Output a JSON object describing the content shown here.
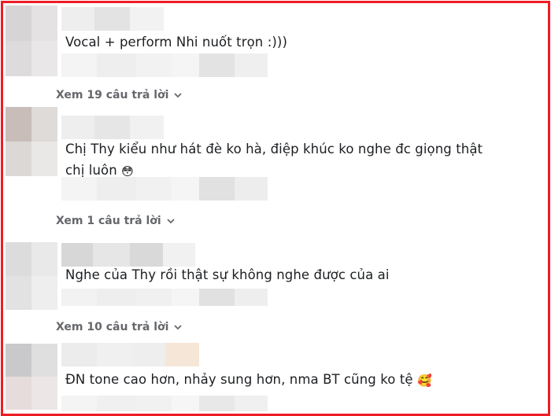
{
  "comments": [
    {
      "text": "Vocal + perform Nhi nuốt trọn :)))",
      "emoji": "",
      "replies_label": "Xem 19 câu trả lời"
    },
    {
      "text": "Chị Thy kiểu như hát đè ko hà, điệp khúc ko nghe đc giọng thật chị luôn",
      "emoji": "😳",
      "replies_label": "Xem 1 câu trả lời"
    },
    {
      "text": "Nghe của Thy rồi thật sự không nghe được của ai",
      "emoji": "",
      "replies_label": "Xem 10 câu trả lời"
    },
    {
      "text": "ĐN tone cao hơn, nhảy sung hơn, nma BT cũng ko tệ",
      "emoji": "🥰",
      "replies_label": ""
    }
  ],
  "colors": {
    "border": "#ee1c25",
    "text": "#1c1e21",
    "secondary": "#65676b"
  }
}
